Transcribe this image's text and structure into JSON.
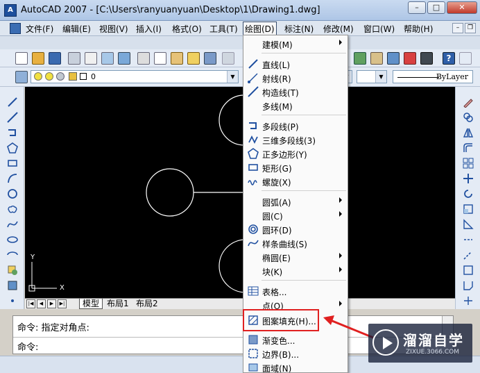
{
  "window": {
    "title": "AutoCAD 2007 - [C:\\Users\\ranyuanyuan\\Desktop\\1\\Drawing1.dwg]",
    "buttons": [
      "–",
      "□",
      "✕"
    ]
  },
  "menubar": {
    "items": [
      "文件(F)",
      "编辑(E)",
      "视图(V)",
      "插入(I)",
      "格式(O)",
      "工具(T)",
      "绘图(D)",
      "标注(N)",
      "修改(M)",
      "窗口(W)",
      "帮助(H)"
    ],
    "active": "绘图(D)"
  },
  "toolbar": {
    "layer_value": "0",
    "linetype_label": "ByLayer"
  },
  "canvas": {
    "ucs_x": "X",
    "ucs_y": "Y"
  },
  "layout_tabs": [
    "模型",
    "布局1",
    "布局2"
  ],
  "command": {
    "line1": "命令: 指定对角点:",
    "line2": "命令:"
  },
  "draw_menu": {
    "items": [
      {
        "label": "建模(M)",
        "icon": "none",
        "submenu": true
      },
      {
        "label": "直线(L)",
        "icon": "line-icon",
        "submenu": false
      },
      {
        "label": "射线(R)",
        "icon": "ray-icon",
        "submenu": false
      },
      {
        "label": "构造线(T)",
        "icon": "xline-icon",
        "submenu": false
      },
      {
        "label": "多线(M)",
        "icon": "none",
        "submenu": false
      },
      {
        "label": "多段线(P)",
        "icon": "polyline-icon",
        "submenu": false
      },
      {
        "label": "三维多段线(3)",
        "icon": "3d-polyline-icon",
        "submenu": false
      },
      {
        "label": "正多边形(Y)",
        "icon": "polygon-icon",
        "submenu": false
      },
      {
        "label": "矩形(G)",
        "icon": "rectangle-icon",
        "submenu": false
      },
      {
        "label": "螺旋(X)",
        "icon": "helix-icon",
        "submenu": false
      },
      {
        "label": "圆弧(A)",
        "icon": "none",
        "submenu": true
      },
      {
        "label": "圆(C)",
        "icon": "none",
        "submenu": true
      },
      {
        "label": "圆环(D)",
        "icon": "donut-icon",
        "submenu": false
      },
      {
        "label": "样条曲线(S)",
        "icon": "spline-icon",
        "submenu": false
      },
      {
        "label": "椭圆(E)",
        "icon": "none",
        "submenu": true
      },
      {
        "label": "块(K)",
        "icon": "none",
        "submenu": true
      },
      {
        "label": "表格...",
        "icon": "table-icon",
        "submenu": false
      },
      {
        "label": "点(O)",
        "icon": "none",
        "submenu": true
      },
      {
        "label": "图案填充(H)...",
        "icon": "hatch-icon",
        "submenu": false
      },
      {
        "label": "渐变色...",
        "icon": "gradient-icon",
        "submenu": false
      },
      {
        "label": "边界(B)...",
        "icon": "boundary-icon",
        "submenu": false
      },
      {
        "label": "面域(N)",
        "icon": "region-icon",
        "submenu": false
      }
    ]
  },
  "watermark": {
    "title": "溜溜自学",
    "subtitle": "ZIXUE.3066.COM"
  },
  "colors": {
    "canvas": "#000000",
    "highlight_box": "#e02020",
    "menu_bg": "#fafafa"
  }
}
